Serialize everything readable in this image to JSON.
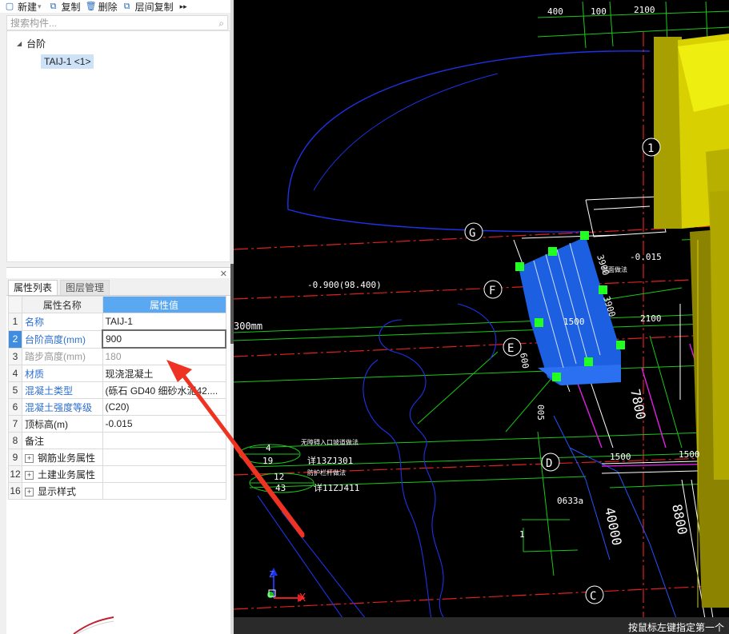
{
  "toolbar": {
    "new_label": "新建",
    "copy_label": "复制",
    "delete_label": "删除",
    "floor_copy_label": "层间复制",
    "more_label": "▸▸"
  },
  "search": {
    "placeholder": "搜索构件..."
  },
  "tree": {
    "root_label": "台阶",
    "child_label": "TAIJ-1 <1>"
  },
  "panel": {
    "tab_properties": "属性列表",
    "tab_layers": "图层管理",
    "col_name": "属性名称",
    "col_value": "属性值",
    "rows": [
      {
        "num": "1",
        "name": "名称",
        "value": "TAIJ-1",
        "style": "blue"
      },
      {
        "num": "2",
        "name": "台阶高度(mm)",
        "value": "900",
        "style": "blue"
      },
      {
        "num": "3",
        "name": "踏步高度(mm)",
        "value": "180",
        "style": "gray"
      },
      {
        "num": "4",
        "name": "材质",
        "value": "现浇混凝土",
        "style": "blue"
      },
      {
        "num": "5",
        "name": "混凝土类型",
        "value": "(砾石 GD40 细砂水泥42....",
        "style": "blue"
      },
      {
        "num": "6",
        "name": "混凝土强度等级",
        "value": "(C20)",
        "style": "blue"
      },
      {
        "num": "7",
        "name": "顶标高(m)",
        "value": "-0.015",
        "style": "normal"
      },
      {
        "num": "8",
        "name": "备注",
        "value": "",
        "style": "normal"
      },
      {
        "num": "9",
        "name": "钢筋业务属性",
        "value": "",
        "style": "group"
      },
      {
        "num": "12",
        "name": "土建业务属性",
        "value": "",
        "style": "group"
      },
      {
        "num": "16",
        "name": "显示样式",
        "value": "",
        "style": "group"
      }
    ]
  },
  "cad": {
    "axis_labels": {
      "g": "G",
      "f": "F",
      "e": "E",
      "d": "D",
      "c": "C",
      "one": "1"
    },
    "dims": {
      "d400": "400",
      "d100": "100",
      "d2100_top": "2100",
      "d015": "-0.015",
      "d900_98": "-0.900(98.400)",
      "d300mm": "300mm",
      "d1500_a": "1500",
      "d2100_mid": "2100",
      "d7800": "7800",
      "d1500_b": "1500",
      "d1500_c": "1500",
      "d40000": "40000",
      "d8800": "8800",
      "d0633": "0633a",
      "d1": "1",
      "d3900a": "3900",
      "d3900b": "3900",
      "d600": "600",
      "d005": "005"
    },
    "notes": {
      "n4": "4",
      "n19": "19",
      "n12": "12",
      "n43": "43",
      "barrier_free": "无障碍入口坡道做法",
      "ref1": "详13ZJ301",
      "guard": "防护栏杆做法",
      "ref2": "详11ZJ411",
      "section_tag": "剖面做法"
    },
    "axis_x": "X",
    "axis_z": "Z",
    "colors": {
      "blue_block": "#1c5fe0",
      "yellow_wall": "#d8d000",
      "red_axis": "#e02020",
      "green_line": "#19c819",
      "arrow": "#ee3322"
    }
  },
  "status": {
    "hint": "按鼠标左键指定第一个"
  }
}
